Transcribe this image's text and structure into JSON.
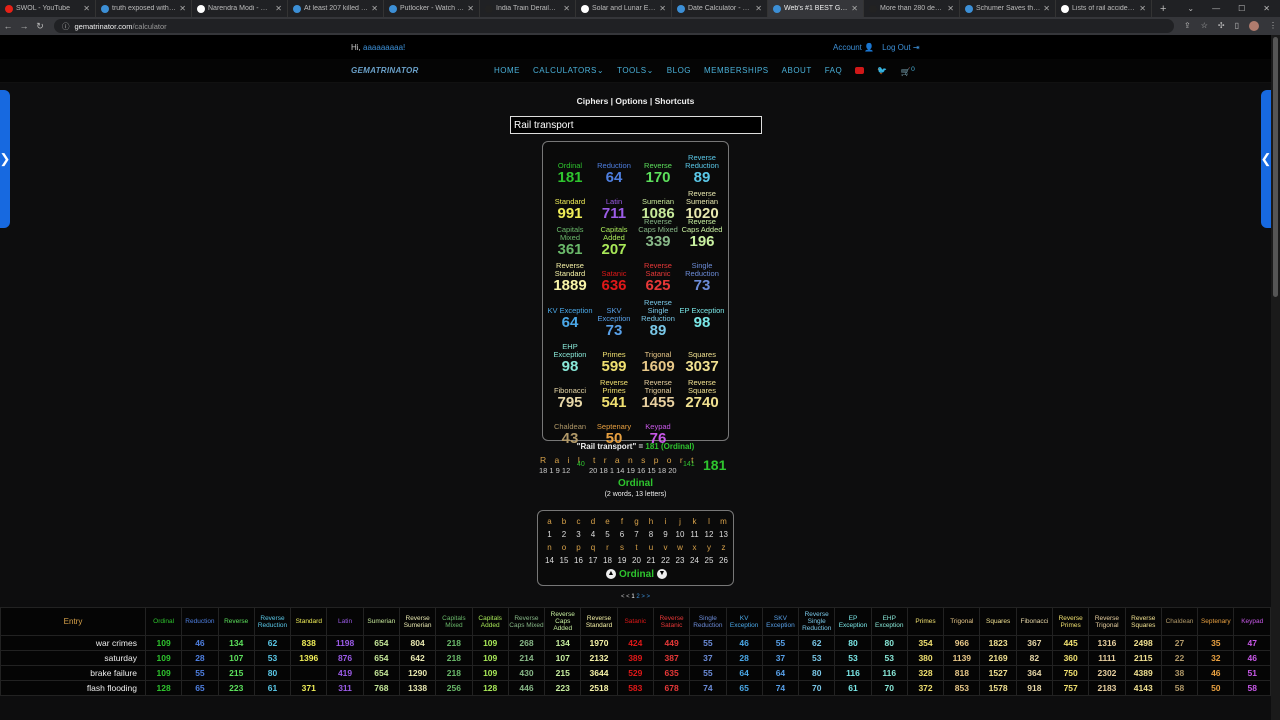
{
  "browser": {
    "tabs": [
      {
        "title": "SWOL - YouTube",
        "color": "#e62117"
      },
      {
        "title": "truth exposed with gem",
        "color": "#3c8fd6"
      },
      {
        "title": "Narendra Modi - Wikip",
        "color": "#ffffff"
      },
      {
        "title": "At least 207 killed and",
        "color": "#3c8fd6"
      },
      {
        "title": "Putlocker - Watch While",
        "color": "#3c8fd6"
      },
      {
        "title": "India Train Derailment",
        "color": "#222222"
      },
      {
        "title": "Solar and Lunar Eclipse",
        "color": "#ffffff"
      },
      {
        "title": "Date Calculator - Gema",
        "color": "#3c8fd6"
      },
      {
        "title": "Web's #1 BEST Gemat",
        "color": "#3c8fd6"
      },
      {
        "title": "More than 280 dead, 9",
        "color": "#222222"
      },
      {
        "title": "Schumer Saves the Day",
        "color": "#3c8fd6"
      },
      {
        "title": "Lists of rail accidents",
        "color": "#ffffff"
      }
    ],
    "active_tab": 8,
    "new_tab": "+",
    "url_host": "gematrinator.com",
    "url_path": "/calculator"
  },
  "site": {
    "greeting": "Hi,",
    "username": "aaaaaaaaa!",
    "account": "Account",
    "logout": "Log Out",
    "logo": "GEMATRINATOR",
    "menu": [
      "HOME",
      "CALCULATORS",
      "TOOLS",
      "BLOG",
      "MEMBERSHIPS",
      "ABOUT",
      "FAQ"
    ],
    "cart_count": "0",
    "subnav": "Ciphers | Options | Shortcuts",
    "search_value": "Rail transport"
  },
  "ciphers": [
    {
      "name": "Ordinal",
      "value": "181",
      "color": "#2ec42e"
    },
    {
      "name": "Reduction",
      "value": "64",
      "color": "#4e7fe0"
    },
    {
      "name": "Reverse",
      "value": "170",
      "color": "#5ce05c"
    },
    {
      "name": "Reverse Reduction",
      "value": "89",
      "color": "#5ac8e8"
    },
    {
      "name": "Standard",
      "value": "991",
      "color": "#f0ee58"
    },
    {
      "name": "Latin",
      "value": "711",
      "color": "#9c5ce8"
    },
    {
      "name": "Sumerian",
      "value": "1086",
      "color": "#c6e89a"
    },
    {
      "name": "Reverse Sumerian",
      "value": "1020",
      "color": "#e8e8b0"
    },
    {
      "name": "Capitals Mixed",
      "value": "361",
      "color": "#6ab86a"
    },
    {
      "name": "Capitals Added",
      "value": "207",
      "color": "#a8e858"
    },
    {
      "name": "Reverse Caps Mixed",
      "value": "339",
      "color": "#88b888"
    },
    {
      "name": "Reverse Caps Added",
      "value": "196",
      "color": "#c8f0a0"
    },
    {
      "name": "Reverse Standard",
      "value": "1889",
      "color": "#f8f4a8"
    },
    {
      "name": "Satanic",
      "value": "636",
      "color": "#e01818"
    },
    {
      "name": "Reverse Satanic",
      "value": "625",
      "color": "#e83838"
    },
    {
      "name": "Single Reduction",
      "value": "73",
      "color": "#6c8cd8"
    },
    {
      "name": "KV Exception",
      "value": "64",
      "color": "#4aa8e8"
    },
    {
      "name": "SKV Exception",
      "value": "73",
      "color": "#58a0e8"
    },
    {
      "name": "Reverse Single Reduction",
      "value": "89",
      "color": "#7ac8e8"
    },
    {
      "name": "EP Exception",
      "value": "98",
      "color": "#7ae8e8"
    },
    {
      "name": "EHP Exception",
      "value": "98",
      "color": "#88e8d8"
    },
    {
      "name": "Primes",
      "value": "599",
      "color": "#f0e070"
    },
    {
      "name": "Trigonal",
      "value": "1609",
      "color": "#e8c888"
    },
    {
      "name": "Squares",
      "value": "3037",
      "color": "#f0e090"
    },
    {
      "name": "Fibonacci",
      "value": "795",
      "color": "#e8d8a8"
    },
    {
      "name": "Reverse Primes",
      "value": "541",
      "color": "#f0e070"
    },
    {
      "name": "Reverse Trigonal",
      "value": "1455",
      "color": "#e8d0a0"
    },
    {
      "name": "Reverse Squares",
      "value": "2740",
      "color": "#f0e090"
    },
    {
      "name": "Chaldean",
      "value": "43",
      "color": "#b09868"
    },
    {
      "name": "Septenary",
      "value": "50",
      "color": "#e8a040"
    },
    {
      "name": "Keypad",
      "value": "76",
      "color": "#c858e8"
    }
  ],
  "summary": {
    "phrase": "\"Rail transport\" =",
    "result": "181 (Ordinal)"
  },
  "breakdown": {
    "word1_letters": "R a i l",
    "word1_nums": "18 1  9 12",
    "word1_sum": "40",
    "word2_letters": "t r a n s p o r t",
    "word2_nums": "20 18 1 14 19 16 15 18 20",
    "word2_sum": "141",
    "total": "181",
    "cipher": "Ordinal",
    "word_count": "(2 words, 13 letters)"
  },
  "cipher_chart": {
    "row1_letters": [
      "a",
      "b",
      "c",
      "d",
      "e",
      "f",
      "g",
      "h",
      "i",
      "j",
      "k",
      "l",
      "m"
    ],
    "row1_nums": [
      "1",
      "2",
      "3",
      "4",
      "5",
      "6",
      "7",
      "8",
      "9",
      "10",
      "11",
      "12",
      "13"
    ],
    "row2_letters": [
      "n",
      "o",
      "p",
      "q",
      "r",
      "s",
      "t",
      "u",
      "v",
      "w",
      "x",
      "y",
      "z"
    ],
    "row2_nums": [
      "14",
      "15",
      "16",
      "17",
      "18",
      "19",
      "20",
      "21",
      "22",
      "23",
      "24",
      "25",
      "26"
    ],
    "name": "Ordinal"
  },
  "pager": {
    "prev": "< <",
    "current": "1",
    "next_pages": "2",
    "next": "> >"
  },
  "history": {
    "entry_header": "Entry",
    "rows": [
      {
        "entry": "war crimes",
        "values": [
          "109",
          "46",
          "134",
          "62",
          "838",
          "1198",
          "654",
          "804",
          "218",
          "109",
          "268",
          "134",
          "1970",
          "424",
          "449",
          "55",
          "46",
          "55",
          "62",
          "80",
          "80",
          "354",
          "966",
          "1823",
          "367",
          "445",
          "1316",
          "2498",
          "27",
          "35",
          "47"
        ]
      },
      {
        "entry": "saturday",
        "values": [
          "109",
          "28",
          "107",
          "53",
          "1396",
          "876",
          "654",
          "642",
          "218",
          "109",
          "214",
          "107",
          "2132",
          "389",
          "387",
          "37",
          "28",
          "37",
          "53",
          "53",
          "53",
          "380",
          "1139",
          "2169",
          "82",
          "360",
          "1111",
          "2115",
          "22",
          "32",
          "46"
        ]
      },
      {
        "entry": "brake failure",
        "values": [
          "109",
          "55",
          "215",
          "80",
          "",
          "419",
          "654",
          "1290",
          "218",
          "109",
          "430",
          "215",
          "3644",
          "529",
          "635",
          "55",
          "64",
          "64",
          "80",
          "116",
          "116",
          "328",
          "818",
          "1527",
          "364",
          "750",
          "2302",
          "4389",
          "38",
          "46",
          "51"
        ]
      },
      {
        "entry": "flash flooding",
        "values": [
          "128",
          "65",
          "223",
          "61",
          "371",
          "311",
          "768",
          "1338",
          "256",
          "128",
          "446",
          "223",
          "2518",
          "583",
          "678",
          "74",
          "65",
          "74",
          "70",
          "61",
          "70",
          "372",
          "853",
          "1578",
          "918",
          "757",
          "2183",
          "4143",
          "58",
          "50",
          "58"
        ]
      }
    ]
  }
}
